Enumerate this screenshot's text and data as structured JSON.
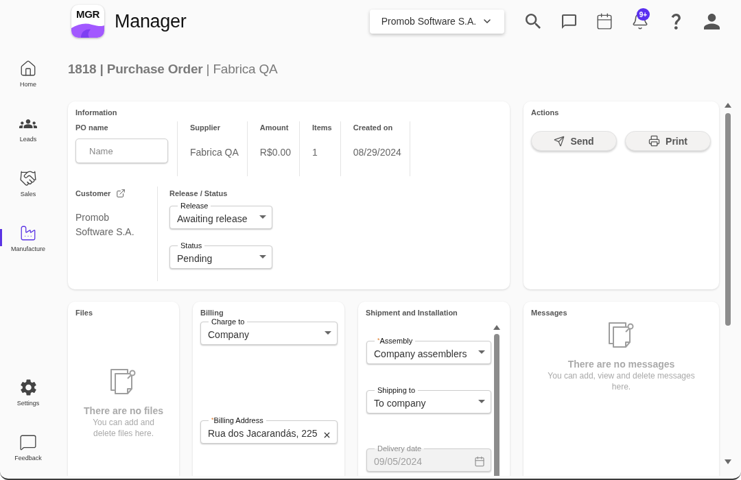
{
  "header": {
    "logo_text": "MGR",
    "app_name": "Manager",
    "company": "Promob Software S.A.",
    "notification_badge": "9+"
  },
  "sidebar": {
    "items": [
      {
        "label": "Home",
        "selected": false
      },
      {
        "label": "Leads",
        "selected": false
      },
      {
        "label": "Sales",
        "selected": false
      },
      {
        "label": "Manufacture",
        "selected": true
      }
    ],
    "bottom_items": [
      {
        "label": "Settings",
        "selected": false
      },
      {
        "label": "Feedback",
        "selected": false
      }
    ]
  },
  "page_title": "**1818 | Purchase Order** | Fabrica QA",
  "information": {
    "title": "Information",
    "po_name": {
      "label": "PO name",
      "placeholder": "Name"
    },
    "summary": [
      {
        "label": "Supplier",
        "value": "Fabrica QA"
      },
      {
        "label": "Amount",
        "value": "R$0.00"
      },
      {
        "label": "Items",
        "value": "1"
      },
      {
        "label": "Created on",
        "value": "08/29/2024"
      }
    ],
    "customer": {
      "label": "Customer",
      "value": "Promob Software S.A."
    },
    "release_status": {
      "title": "Release / Status",
      "fields": [
        {
          "kind": "select",
          "label": "Release",
          "value": "Awaiting release"
        },
        {
          "kind": "select",
          "label": "Status",
          "value": "Pending"
        }
      ]
    }
  },
  "actions": {
    "title": "Actions",
    "buttons": [
      "Send",
      "Print"
    ]
  },
  "files": {
    "title": "Files",
    "empty_title": "There are no files",
    "empty_text": "You can add and delete files here."
  },
  "billing": {
    "title": "Billing",
    "fields": [
      {
        "kind": "select",
        "label": "Charge to",
        "value": "Company"
      },
      {
        "kind": "text",
        "label": "$^{*}$Billing Address",
        "value": "Rua dos Jacarandás, 225"
      }
    ]
  },
  "shipment": {
    "title": "Shipment and Installation",
    "fields": [
      {
        "kind": "select",
        "label": "$^{*}$Assembly",
        "value": "Company assemblers",
        "disabled": false
      },
      {
        "kind": "select",
        "label": "Shipping to",
        "value": "To company",
        "disabled": false
      },
      {
        "kind": "date",
        "label": "Delivery date",
        "value": "09/05/2024",
        "disabled": true
      }
    ]
  },
  "messages": {
    "title": "Messages",
    "empty_title": "There are no messages",
    "empty_text": "You can add, view and delete messages here."
  }
}
